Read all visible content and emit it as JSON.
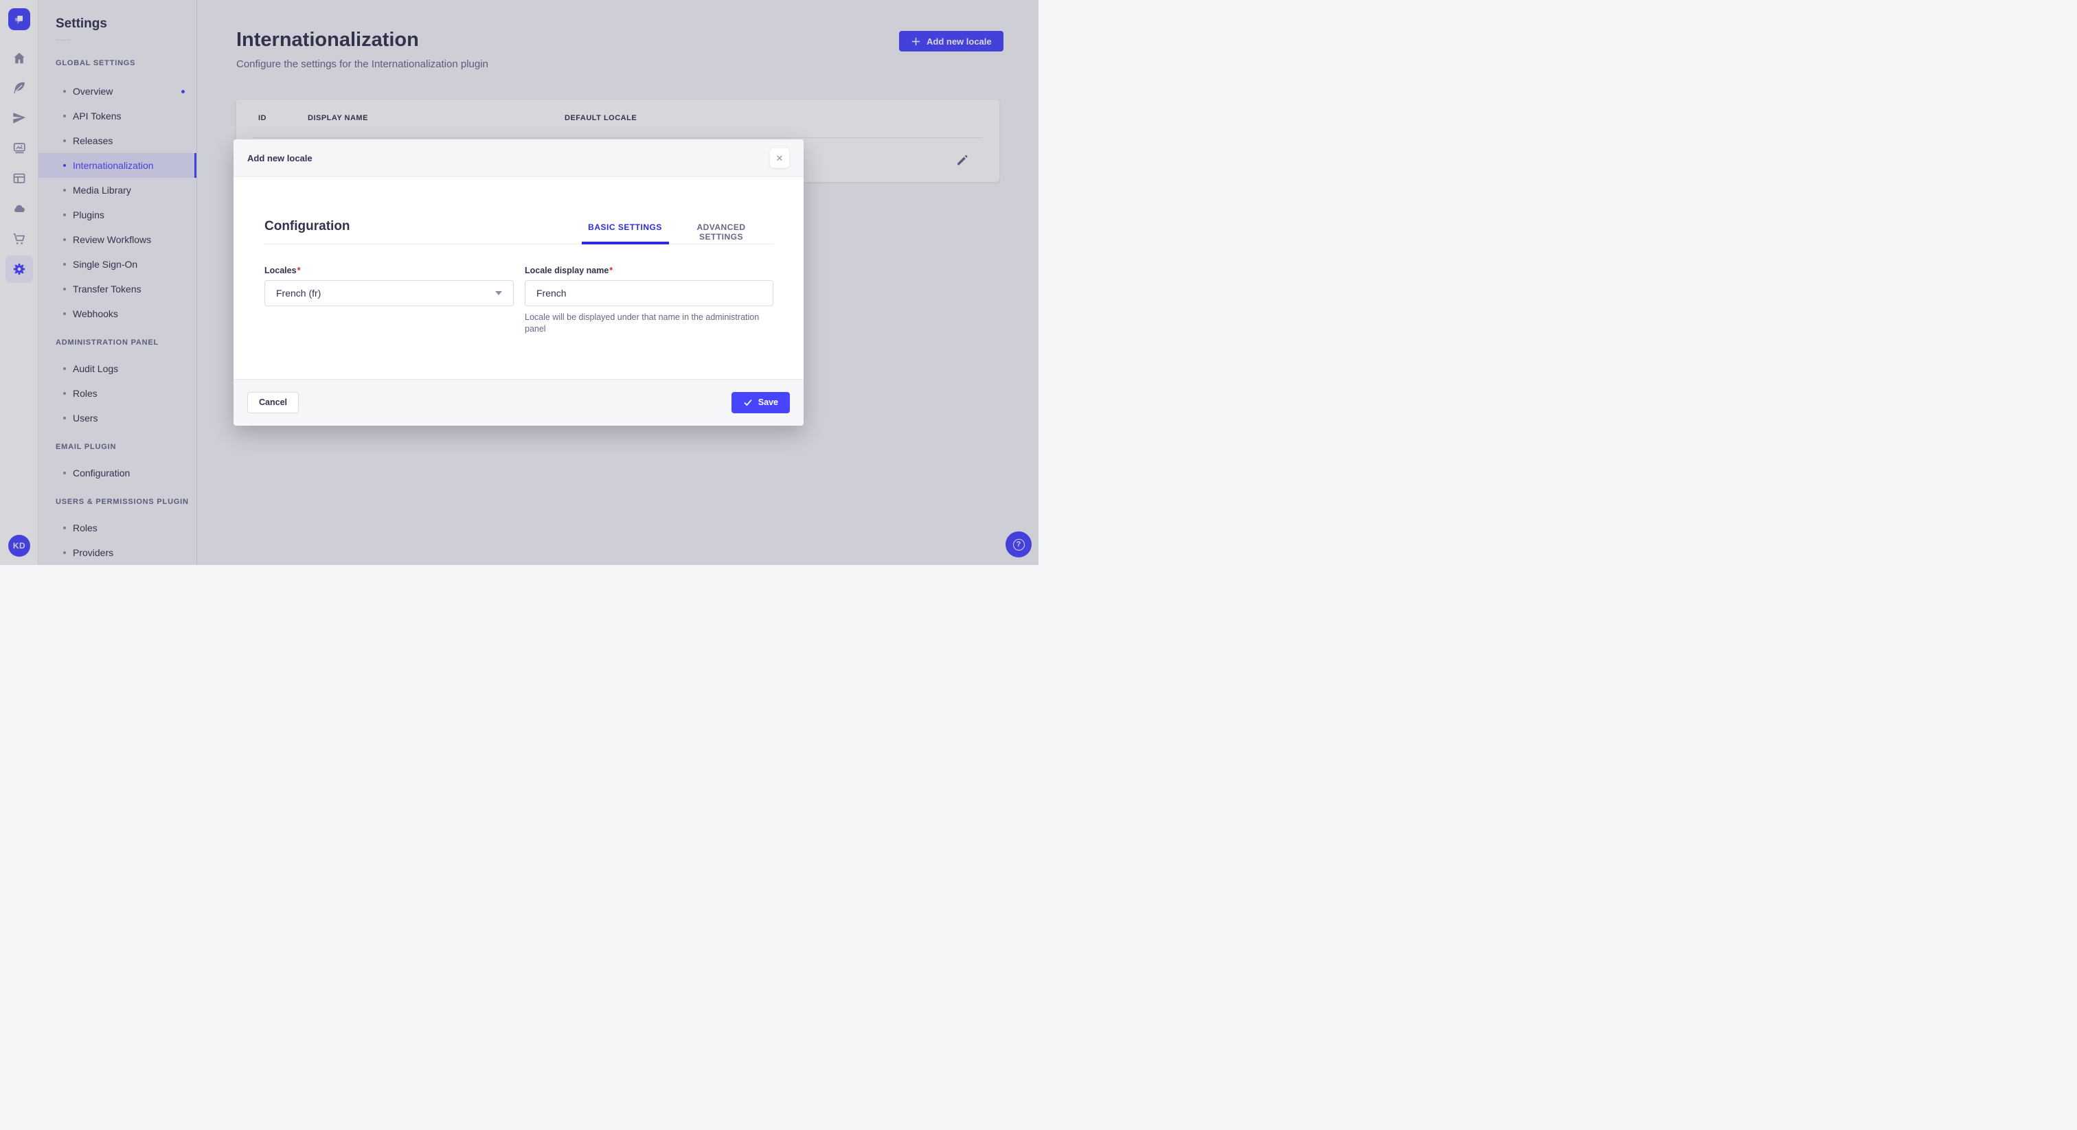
{
  "colors": {
    "accent": "#4945ff",
    "active_tab": "#2f2ae0",
    "text_primary": "#32324d",
    "text_secondary": "#666687",
    "required_red": "#d02b20",
    "subnav_active_bg": "#e4e3fc"
  },
  "rail": {
    "logo_icon": "strapi-logo",
    "icons": [
      "home",
      "feather",
      "paper-plane",
      "media-library",
      "layout",
      "cloud",
      "cart",
      "settings"
    ],
    "active_icon": "settings",
    "avatar_initials": "KD"
  },
  "sidebar": {
    "title": "Settings",
    "sections": [
      {
        "label": "GLOBAL SETTINGS",
        "items": [
          {
            "label": "Overview",
            "notification": true
          },
          {
            "label": "API Tokens"
          },
          {
            "label": "Releases"
          },
          {
            "label": "Internationalization",
            "active": true
          },
          {
            "label": "Media Library"
          },
          {
            "label": "Plugins"
          },
          {
            "label": "Review Workflows"
          },
          {
            "label": "Single Sign-On"
          },
          {
            "label": "Transfer Tokens"
          },
          {
            "label": "Webhooks"
          }
        ]
      },
      {
        "label": "ADMINISTRATION PANEL",
        "items": [
          {
            "label": "Audit Logs"
          },
          {
            "label": "Roles"
          },
          {
            "label": "Users"
          }
        ]
      },
      {
        "label": "EMAIL PLUGIN",
        "items": [
          {
            "label": "Configuration"
          }
        ]
      },
      {
        "label": "USERS & PERMISSIONS PLUGIN",
        "items": [
          {
            "label": "Roles"
          },
          {
            "label": "Providers"
          }
        ]
      }
    ]
  },
  "page": {
    "title": "Internationalization",
    "subtitle": "Configure the settings for the Internationalization plugin",
    "add_button_label": "Add new locale"
  },
  "table": {
    "columns": [
      "ID",
      "DISPLAY NAME",
      "DEFAULT LOCALE"
    ],
    "row_action_icon": "pencil"
  },
  "modal": {
    "title": "Add new locale",
    "section_title": "Configuration",
    "tabs": [
      {
        "label": "BASIC SETTINGS",
        "active": true
      },
      {
        "label": "ADVANCED SETTINGS",
        "active": false
      }
    ],
    "form": {
      "locales": {
        "label": "Locales",
        "required_mark": "*",
        "value": "French (fr)"
      },
      "display_name": {
        "label": "Locale display name",
        "required_mark": "*",
        "value": "French",
        "help": "Locale will be displayed under that name in the administration panel"
      }
    },
    "footer": {
      "cancel_label": "Cancel",
      "save_label": "Save"
    }
  },
  "icons": {
    "close": "✕",
    "question": "?"
  }
}
